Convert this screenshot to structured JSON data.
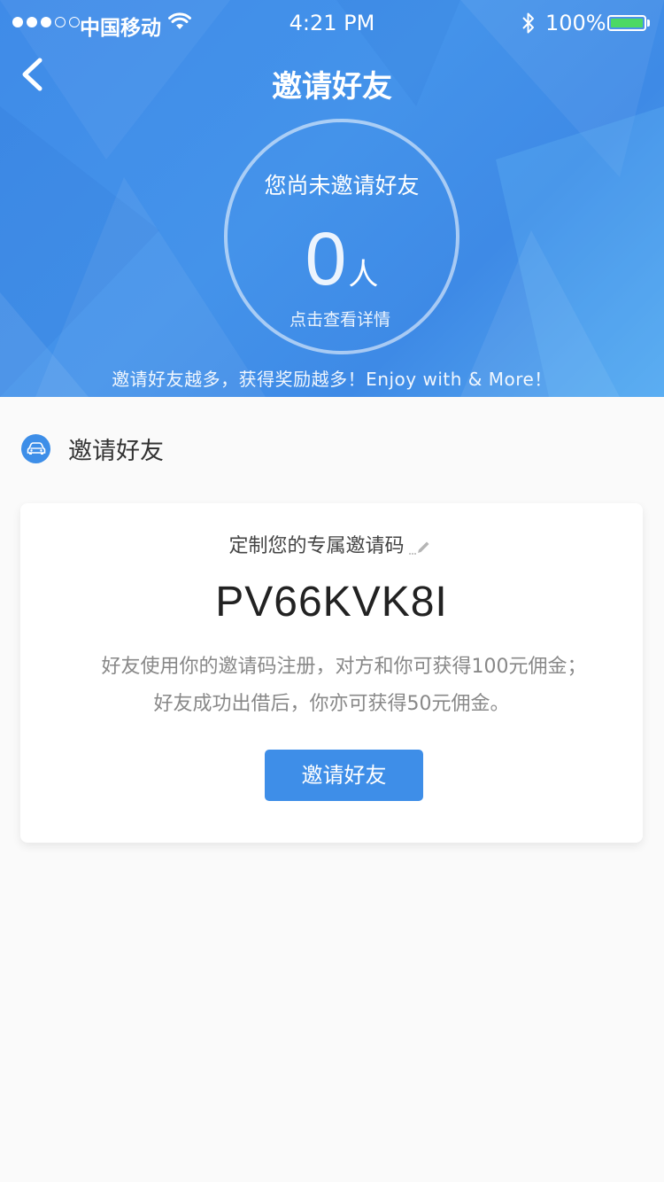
{
  "status_bar": {
    "carrier": "中国移动",
    "time": "4:21 PM",
    "battery": "100%",
    "signal_dots": [
      true,
      true,
      true,
      false,
      false
    ]
  },
  "nav": {
    "title": "邀请好友",
    "back_icon": "chevron-left-icon"
  },
  "summary": {
    "title": "您尚未邀请好友",
    "count": "0",
    "unit": "人",
    "hint": "点击查看详情"
  },
  "slogan": "邀请好友越多，获得奖励越多！Enjoy with & More！",
  "section": {
    "icon": "car-icon",
    "title": "邀请好友"
  },
  "card": {
    "subtitle": "定制您的专属邀请码",
    "edit_icon": "pencil-icon",
    "code": "PV66KVK8I",
    "desc_line1": "好友使用你的邀请码注册，对方和你可获得100元佣金；",
    "desc_line2": "好友成功出借后，你亦可获得50元佣金。",
    "button_label": "邀请好友"
  },
  "colors": {
    "brand_blue": "#3e8ee8",
    "battery_green": "#4cd964",
    "page_bg": "#fafafa"
  }
}
